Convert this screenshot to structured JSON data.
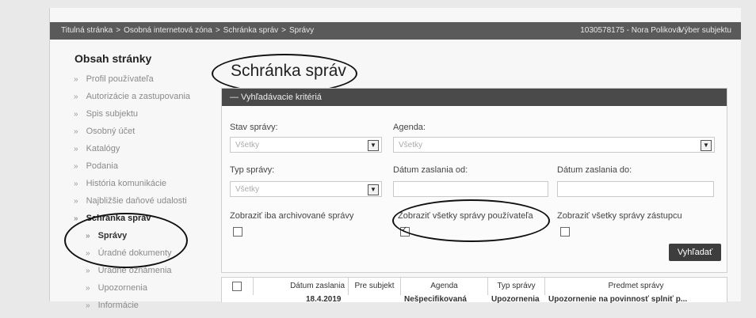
{
  "topbar": {
    "breadcrumbs": [
      "Titulná stránka",
      "Osobná internetová zóna",
      "Schránka správ",
      "Správy"
    ],
    "separator": ">",
    "user": "1030578175 - Nora Poliková",
    "subject_link": "Výber subjektu"
  },
  "sidebar": {
    "title": "Obsah stránky",
    "items": [
      {
        "label": "Profil používateľa"
      },
      {
        "label": "Autorizácie a zastupovania"
      },
      {
        "label": "Spis subjektu"
      },
      {
        "label": "Osobný účet"
      },
      {
        "label": "Katalógy"
      },
      {
        "label": "Podania"
      },
      {
        "label": "História komunikácie"
      },
      {
        "label": "Najbližšie daňové udalosti"
      },
      {
        "label": "Schránka správ"
      },
      {
        "label": "Správy"
      },
      {
        "label": "Úradné dokumenty"
      },
      {
        "label": "Úradné oznámenia"
      },
      {
        "label": "Upozornenia"
      },
      {
        "label": "Informácie"
      }
    ],
    "chevron": "»"
  },
  "main": {
    "title": "Schránka správ",
    "panel_title": "— Vyhľadávacie kritériá",
    "filters": {
      "stav_label": "Stav správy:",
      "stav_value": "Všetky",
      "agenda_label": "Agenda:",
      "agenda_value": "Všetky",
      "typ_label": "Typ správy:",
      "typ_value": "Všetky",
      "datum_od_label": "Dátum zaslania od:",
      "datum_do_label": "Dátum zaslania do:",
      "archiv_label": "Zobraziť iba archivované správy",
      "vsetky_pouz_label": "Zobraziť všetky správy používateľa",
      "vsetky_zast_label": "Zobraziť všetky správy zástupcu",
      "search_button": "Vyhľadať"
    },
    "table": {
      "headers": [
        "Dátum zaslania",
        "Pre subjekt",
        "Agenda",
        "Typ správy",
        "Predmet správy"
      ],
      "first_row": [
        "18.4.2019",
        "Nešpecifikovaná",
        "Upozornenia",
        "Upozornenie na povinnosť splniť p..."
      ]
    }
  }
}
